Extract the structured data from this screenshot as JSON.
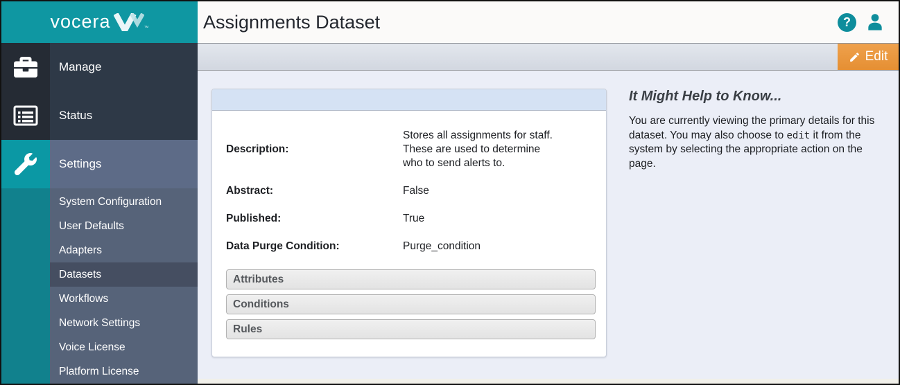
{
  "brand": {
    "logo_text": "vocera",
    "trademark": "™",
    "teal": "#0f97a2"
  },
  "header": {
    "title": "Assignments Dataset",
    "help_icon_glyph": "?",
    "icons": [
      "help-icon",
      "user-icon"
    ]
  },
  "toolbar": {
    "edit_label": "Edit"
  },
  "sidebar": {
    "items": [
      {
        "label": "Manage",
        "icon": "briefcase-icon",
        "selected": false
      },
      {
        "label": "Status",
        "icon": "status-list-icon",
        "selected": false
      },
      {
        "label": "Settings",
        "icon": "wrench-icon",
        "selected": true
      }
    ],
    "subitems": [
      {
        "label": "System Configuration",
        "selected": false
      },
      {
        "label": "User Defaults",
        "selected": false
      },
      {
        "label": "Adapters",
        "selected": false
      },
      {
        "label": "Datasets",
        "selected": true
      },
      {
        "label": "Workflows",
        "selected": false
      },
      {
        "label": "Network Settings",
        "selected": false
      },
      {
        "label": "Voice License",
        "selected": false
      },
      {
        "label": "Platform License",
        "selected": false
      }
    ]
  },
  "details": {
    "fields": [
      {
        "label": "Description:",
        "value": "Stores all assignments for staff. These are used to determine who to send alerts to."
      },
      {
        "label": "Abstract:",
        "value": "False"
      },
      {
        "label": "Published:",
        "value": "True"
      },
      {
        "label": "Data Purge Condition:",
        "value": "Purge_condition"
      }
    ],
    "sections": [
      "Attributes",
      "Conditions",
      "Rules"
    ]
  },
  "help": {
    "heading": "It Might Help to Know...",
    "body_before": "You are currently viewing the primary details for this dataset. You may also choose to ",
    "code_word": "edit",
    "body_after": " it from the system by selecting the appropriate action on the page."
  },
  "colors": {
    "accent_teal": "#0f97a2",
    "edit_orange": "#e8963e",
    "card_header_blue": "#d5e2f4",
    "sidebar_dark": "#2e3947",
    "sidebar_slate": "#566379",
    "selected_subitem": "#454e61"
  }
}
